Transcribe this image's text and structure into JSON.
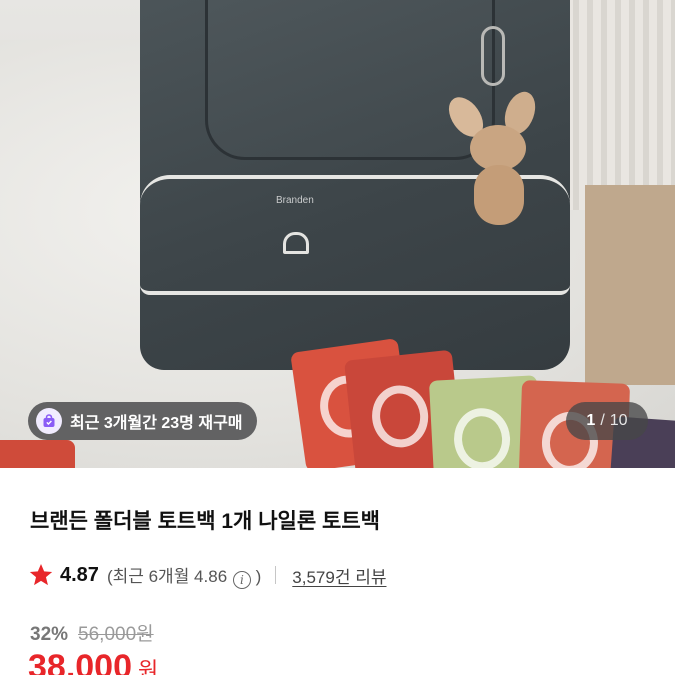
{
  "gallery": {
    "bag_brand_text": "Branden",
    "repurchase_badge": "최근 3개월간 23명 재구매",
    "current_index": "1",
    "separator": "/",
    "total": "10"
  },
  "product": {
    "title": "브랜든 폴더블 토트백 1개 나일론 토트백",
    "rating": "4.87",
    "recent_rating_text": "(최근 6개월 4.86",
    "info_icon_glyph": "i",
    "recent_rating_close": ")",
    "review_count": "3,579건 리뷰",
    "discount_rate": "32%",
    "original_price": "56,000원",
    "sale_price": "38,000",
    "sale_currency": "원"
  },
  "icons": {
    "star": "star-icon",
    "cart": "shopping-bag-icon",
    "info": "info-icon"
  },
  "colors": {
    "accent_red": "#e8262a",
    "star_red": "#e8262a",
    "badge_purple": "#8a5cf6"
  }
}
